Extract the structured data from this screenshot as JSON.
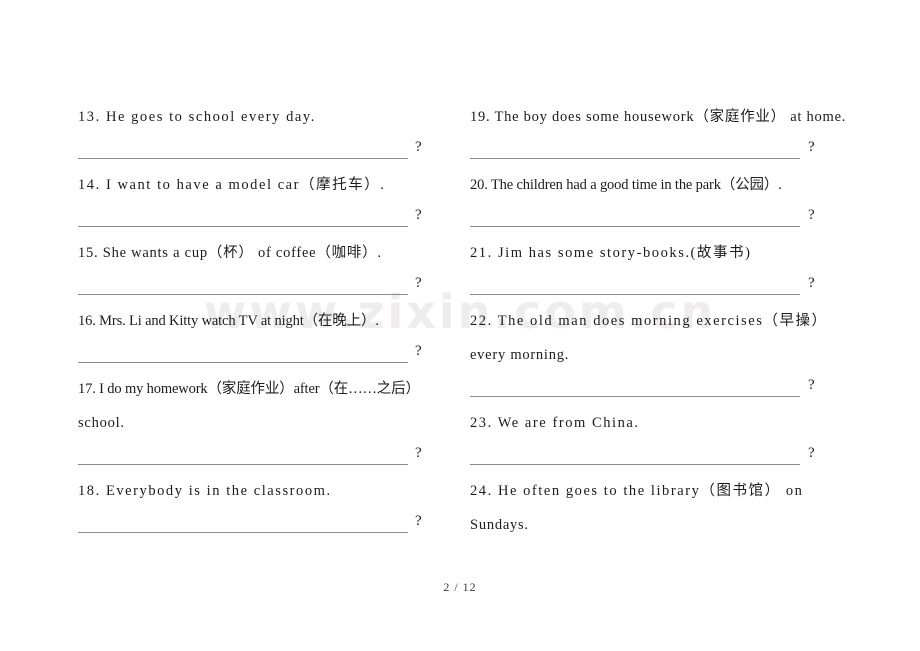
{
  "document": {
    "watermark": "www.zixin.com.cn",
    "footer": "2 / 12"
  },
  "left_column": {
    "items": [
      {
        "number": "13.",
        "lines": [
          "13.  He goes to school every day."
        ],
        "answer_mark": "?"
      },
      {
        "number": "14.",
        "lines": [
          "14.  I want to have a model car（摩托车）."
        ],
        "answer_mark": "?"
      },
      {
        "number": "15.",
        "lines": [
          "15.  She wants a cup（杯） of coffee（咖啡）."
        ],
        "answer_mark": "?"
      },
      {
        "number": "16.",
        "lines": [
          "16. Mrs. Li and Kitty watch TV at night（在晚上）."
        ],
        "answer_mark": "?"
      },
      {
        "number": "17.",
        "lines": [
          "17. I do my homework（家庭作业）after（在……之后）",
          "school."
        ],
        "answer_mark": "?"
      },
      {
        "number": "18.",
        "lines": [
          "18.  Everybody is in the classroom."
        ],
        "answer_mark": "?"
      }
    ]
  },
  "right_column": {
    "items": [
      {
        "number": "19.",
        "lines": [
          "19.  The boy does some housework（家庭作业） at home."
        ],
        "answer_mark": "?"
      },
      {
        "number": "20.",
        "lines": [
          "20. The children had a good time in the park（公园）."
        ],
        "answer_mark": "?"
      },
      {
        "number": "21.",
        "lines": [
          "21.  Jim has some story-books.(故事书)"
        ],
        "answer_mark": "?"
      },
      {
        "number": "22.",
        "lines": [
          "22.  The old man does morning exercises（早操）",
          "every morning."
        ],
        "answer_mark": "?"
      },
      {
        "number": "23.",
        "lines": [
          "23.  We are from China."
        ],
        "answer_mark": "?"
      },
      {
        "number": "24.",
        "lines": [
          "24.  He often goes to the library（图书馆） on",
          "Sundays."
        ],
        "answer_mark": null
      }
    ]
  }
}
